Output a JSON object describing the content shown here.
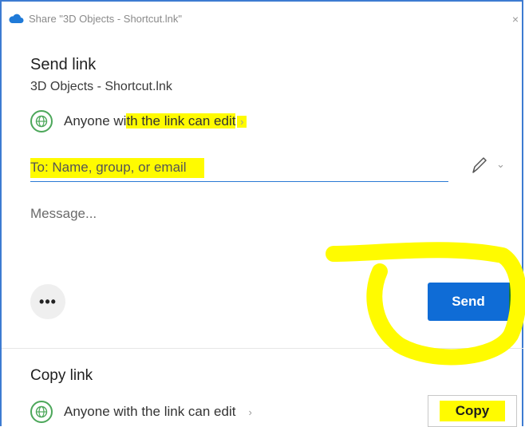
{
  "window": {
    "title": "Share \"3D Objects - Shortcut.lnk\"",
    "close_label": "×"
  },
  "send": {
    "heading": "Send link",
    "subheading": "3D Objects - Shortcut.lnk",
    "permission_prefix": "Anyone wi",
    "permission_highlight": "th the link can edit",
    "to_placeholder": "To: Name, group, or email",
    "message_placeholder": "Message...",
    "more_label": "•••",
    "send_label": "Send"
  },
  "copy": {
    "heading": "Copy link",
    "permission": "Anyone with the link can edit",
    "copy_label": "Copy"
  },
  "colors": {
    "accent": "#0f6cd6",
    "highlight": "#fffb00",
    "globe": "#4ca75a"
  },
  "icons": [
    "onedrive-cloud-icon",
    "globe-icon",
    "pencil-icon",
    "chevron-down-icon",
    "chevron-right-icon"
  ]
}
